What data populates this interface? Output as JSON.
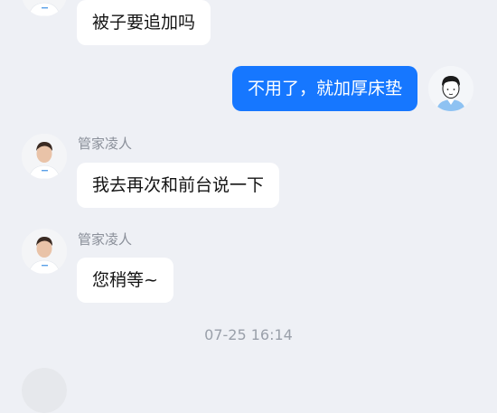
{
  "colors": {
    "background": "#eef0f5",
    "incoming_bubble": "#ffffff",
    "outgoing_bubble": "#1677ff",
    "sender_name": "#8a8f99",
    "timestamp": "#9aa0aa"
  },
  "messages": [
    {
      "direction": "incoming",
      "avatar": "butler-avatar",
      "text": "被子要追加吗"
    },
    {
      "direction": "outgoing",
      "avatar": "user-avatar",
      "text": "不用了，就加厚床垫"
    },
    {
      "direction": "incoming",
      "avatar": "butler-avatar",
      "sender": "管家凌人",
      "text": "我去再次和前台说一下"
    },
    {
      "direction": "incoming",
      "avatar": "butler-avatar",
      "sender": "管家凌人",
      "text": "您稍等~"
    }
  ],
  "timestamp": "07-25 16:14"
}
